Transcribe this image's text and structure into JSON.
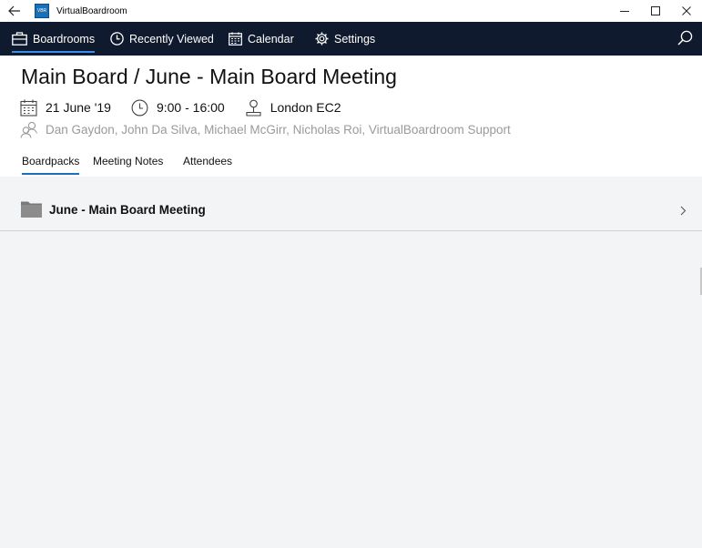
{
  "window": {
    "title": "VirtualBoardroom",
    "logo_text": "VBR"
  },
  "nav": {
    "items": [
      {
        "label": "Boardrooms",
        "icon": "briefcase-icon",
        "active": true
      },
      {
        "label": "Recently Viewed",
        "icon": "clock-icon",
        "active": false
      },
      {
        "label": "Calendar",
        "icon": "calendar-icon",
        "active": false
      },
      {
        "label": "Settings",
        "icon": "gear-icon",
        "active": false
      }
    ],
    "colors": {
      "background": "#0f1a2e",
      "active_underline": "#3a8ee6"
    }
  },
  "meeting": {
    "title": "Main Board / June - Main Board Meeting",
    "date": "21 June '19",
    "time": "9:00 - 16:00",
    "location": "London EC2",
    "attendees": "Dan Gaydon, John Da Silva, Michael McGirr, Nicholas Roi, VirtualBoardroom Support"
  },
  "tabs": [
    {
      "label": "Boardpacks",
      "active": true
    },
    {
      "label": "Meeting Notes",
      "active": false
    },
    {
      "label": "Attendees",
      "active": false
    }
  ],
  "boardpacks": [
    {
      "title": "June - Main Board Meeting"
    }
  ]
}
